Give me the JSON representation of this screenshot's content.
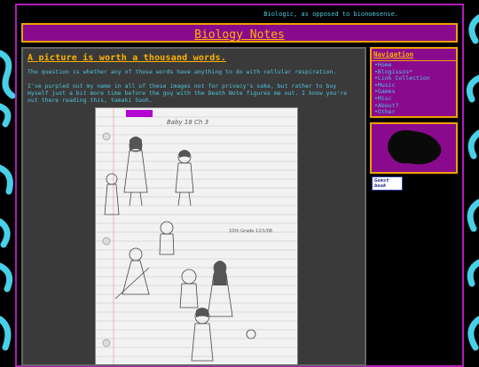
{
  "tagline": "Biologic, as opposed to bionomsense.",
  "header": {
    "title": "Biology Notes"
  },
  "post": {
    "title": "A picture is worth a thousand words.",
    "paragraphs": [
      "The question is whether any of those words have anything to do with cellular respiration.",
      "I've purpled out my name in all of these images not for privacy's sake, but rather to buy myself just a bit more time before the guy with the Death Note figures me out. I know you're out there reading this, Yamaki Sooh."
    ],
    "drawing_text": {
      "title": "Baby 18 Ch 3",
      "note": "10th Grade 12/1/06"
    }
  },
  "sidebar": {
    "nav_title": "Navigation",
    "items": [
      "Home",
      "Blogissos*",
      "Link Collection",
      "Music",
      "Games",
      "Misc",
      "About?",
      "Other"
    ]
  },
  "guestbook": {
    "label": "Guest book"
  },
  "colors": {
    "background": "#000000",
    "frame": "#b01cb8",
    "panel": "#8a0a8e",
    "accent": "#ffb300",
    "text": "#4ec6e0",
    "squiggle": "#48d0e8"
  }
}
